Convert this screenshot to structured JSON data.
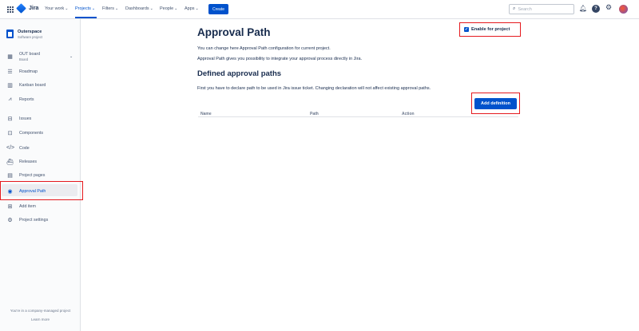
{
  "topnav": {
    "logo": "Jira",
    "items": [
      {
        "label": "Your work",
        "chevron": true
      },
      {
        "label": "Projects",
        "chevron": true
      },
      {
        "label": "Filters",
        "chevron": true
      },
      {
        "label": "Dashboards",
        "chevron": true
      },
      {
        "label": "People",
        "chevron": true
      },
      {
        "label": "Apps",
        "chevron": true
      }
    ],
    "active_item": "Projects",
    "create_label": "Create",
    "search_placeholder": "Search",
    "accent_color": "#0052cc"
  },
  "sidebar": {
    "project_name": "Outerspace",
    "project_type": "Software project",
    "board_name": "OUT board",
    "board_sub": "Board",
    "items": [
      {
        "label": "Roadmap",
        "icon": "roadmap-icon"
      },
      {
        "label": "Kanban board",
        "icon": "board-icon"
      },
      {
        "label": "Reports",
        "icon": "chart-icon"
      },
      {
        "label": "Issues",
        "icon": "issues-icon"
      },
      {
        "label": "Components",
        "icon": "components-icon"
      },
      {
        "label": "Code",
        "icon": "code-icon"
      },
      {
        "label": "Releases",
        "icon": "ship-icon"
      },
      {
        "label": "Project pages",
        "icon": "page-icon"
      },
      {
        "label": "Approval Path",
        "icon": "approval-icon"
      },
      {
        "label": "Add item",
        "icon": "add-icon"
      },
      {
        "label": "Project settings",
        "icon": "gear-icon"
      }
    ],
    "selected_item": "Approval Path",
    "footer_text": "You're in a company-managed project",
    "footer_link": "Learn more"
  },
  "main": {
    "title": "Approval Path",
    "enable_label": "Enable for project",
    "enable_checked": true,
    "intro1": "You can change here Approval Path configuration for current project.",
    "intro2": "Approval Path gives you possibility to integrate your approval process directly in Jira.",
    "section_title": "Defined approval paths",
    "section_text": "First you have to declare path to be used in Jira issue ticket. Changing declaration will not affect existing approval paths.",
    "add_button": "Add definition",
    "columns": [
      "Name",
      "Path",
      "Action"
    ]
  }
}
